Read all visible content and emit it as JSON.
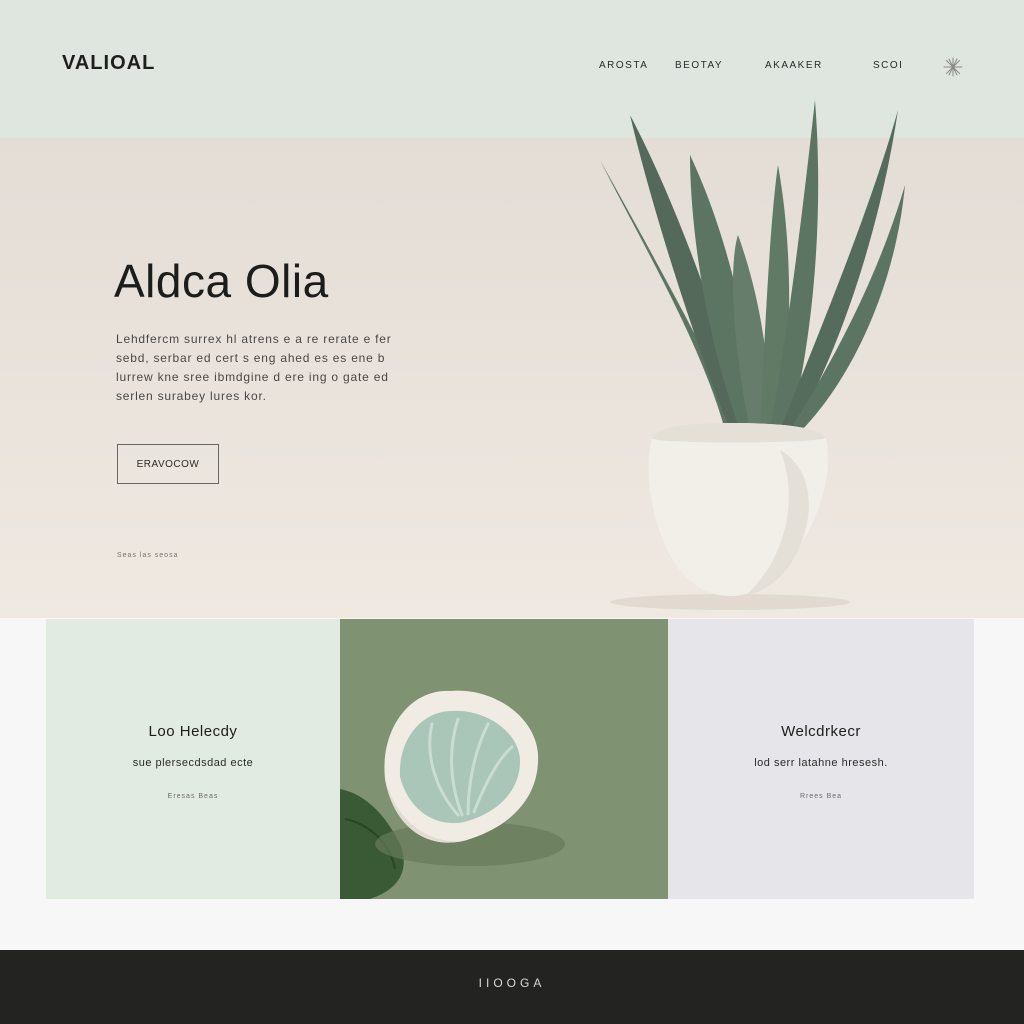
{
  "brand": {
    "logo": "VALIOAL"
  },
  "nav": {
    "items": [
      {
        "label": "AROSTA"
      },
      {
        "label": "BEOTAY"
      },
      {
        "label": "AKAAKER"
      },
      {
        "label": "SCOI"
      }
    ],
    "menu_icon": "sparkle-icon"
  },
  "hero": {
    "title": "Aldca Olia",
    "body": "Lehdfercm surrex hl atrens e a re rerate e fer sebd, serbar ed cert s eng ahed es es ene b lurrew kne sree ibmdgine d ere ing o gate ed serlen surabey lures kor.",
    "cta_label": "ERAVOCOW",
    "meta": "Seas  las  seosa",
    "image": "aloe-plant-in-white-pot"
  },
  "cards": [
    {
      "title": "Loo Helecdy",
      "text": "sue plersecdsdad ecte",
      "link": "Eresas Beas"
    },
    {
      "image": "ceramic-dish-with-aloe-gel"
    },
    {
      "title": "Welcdrkecr",
      "text": "lod serr latahne hresesh.",
      "link": "Rrees Bea"
    }
  ],
  "footer": {
    "text": "IIOOGA"
  },
  "colors": {
    "header_bg": "#dfe6e0",
    "hero_bg": "#e7e0d9",
    "card_mint": "#e2ebe2",
    "card_sage": "#7f9272",
    "card_grey": "#e6e6ea",
    "footer_bg": "#232322",
    "leaf_green": "#5c7462"
  }
}
